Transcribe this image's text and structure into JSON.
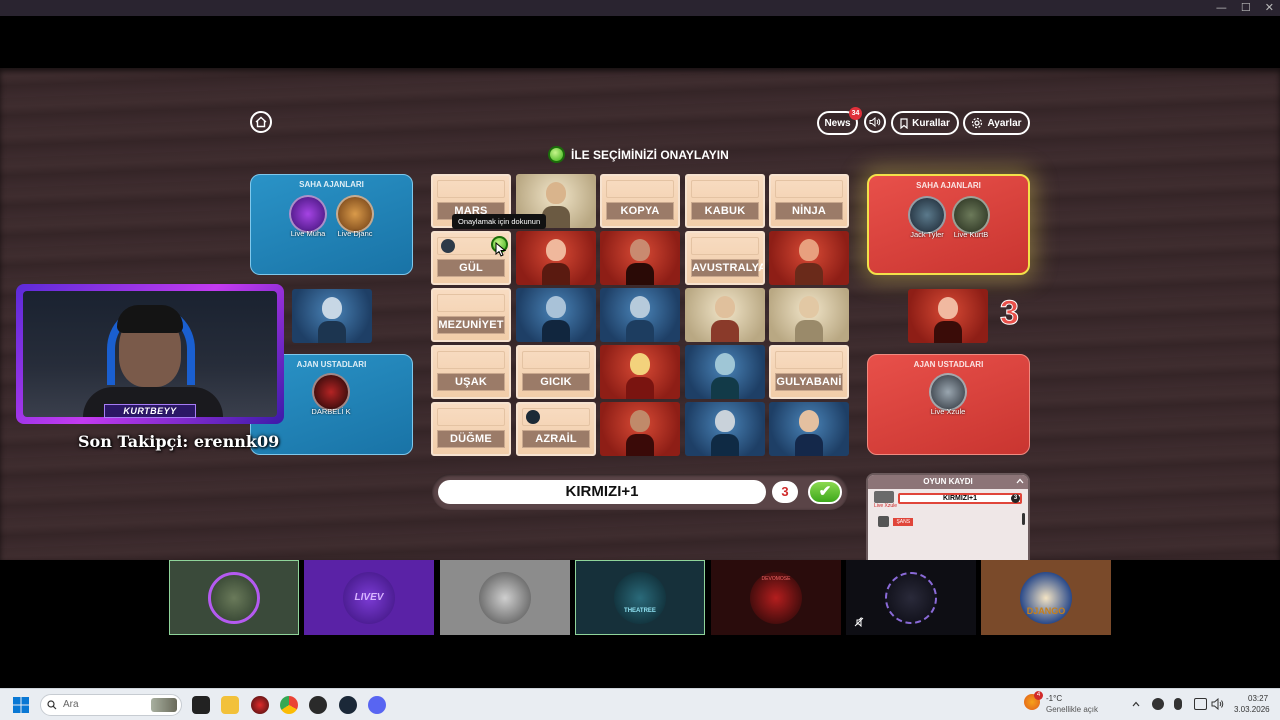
{
  "window": {
    "controls": [
      "—",
      "☐",
      "✕"
    ]
  },
  "header": {
    "news_label": "News",
    "news_badge": "34",
    "rules_label": "Kurallar",
    "settings_label": "Ayarlar"
  },
  "instruction": "İLE SEÇİMİNİZİ ONAYLAYIN",
  "tooltip": "Onaylamak için dokunun",
  "blue_team": {
    "field_title": "SAHA AJANLARI",
    "field_agents": [
      "Live Muha",
      "Live Djanc"
    ],
    "master_title": "AJAN USTADLARI",
    "master_agents": [
      "DARBELİ K"
    ]
  },
  "red_team": {
    "field_title": "SAHA AJANLARI",
    "field_agents": [
      "Jack Tyler",
      "Live KurtB"
    ],
    "master_title": "AJAN USTADLARI",
    "master_agents": [
      "Live Xzule"
    ],
    "remaining": "3"
  },
  "board": [
    [
      "MARS",
      "",
      "KOPYA",
      "KABUK",
      "NİNJA"
    ],
    [
      "GÜL",
      "",
      "",
      "AVUSTRALYA",
      ""
    ],
    [
      "MEZUNİYET",
      "",
      "",
      "",
      ""
    ],
    [
      "UŞAK",
      "GICIK",
      "",
      "",
      "GULYABANİ"
    ],
    [
      "DÜĞME",
      "AZRAİL",
      "",
      "",
      ""
    ]
  ],
  "clue": {
    "word": "KIRMIZI+1",
    "number": "3",
    "confirm": "✔"
  },
  "log": {
    "title": "OYUN KAYDI",
    "entry_word": "KIRMIZI+1",
    "entry_num": "3",
    "entry_user": "Live Xzule",
    "entry2": "ŞANS"
  },
  "stream": {
    "cam_name": "KURTBEYY",
    "follower": "Son Takipçi: erennk09"
  },
  "players": [
    "",
    "LIVEV",
    "",
    "THEATREE",
    "DEVOMOSE",
    "",
    "DJANGO"
  ],
  "taskbar": {
    "search_placeholder": "Ara",
    "weather_temp": "-1°C",
    "weather_desc": "Genellikle açık",
    "weather_badge": "4",
    "time": "03:27",
    "date": "3.03.2026"
  },
  "colors": {
    "red_team": "#e8504a",
    "blue_team": "#2a93c7",
    "confirm": "#3ea81c"
  }
}
